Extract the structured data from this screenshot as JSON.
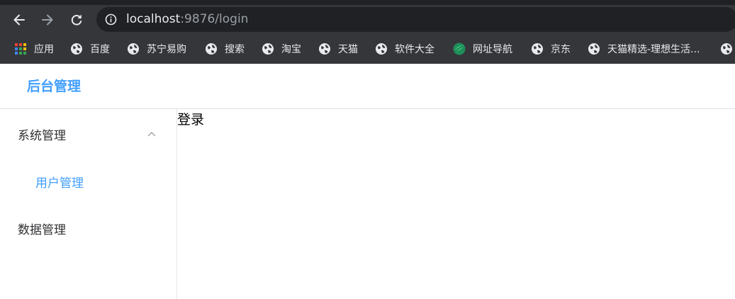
{
  "browser": {
    "url_host": "localhost",
    "url_rest": ":9876/login",
    "bookmarks": [
      {
        "label": "应用",
        "icon": "apps-grid-icon"
      },
      {
        "label": "百度",
        "icon": "globe-icon"
      },
      {
        "label": "苏宁易购",
        "icon": "globe-icon"
      },
      {
        "label": "搜索",
        "icon": "globe-icon"
      },
      {
        "label": "淘宝",
        "icon": "globe-icon"
      },
      {
        "label": "天猫",
        "icon": "globe-icon"
      },
      {
        "label": "软件大全",
        "icon": "globe-icon"
      },
      {
        "label": "网址导航",
        "icon": "green-leaf-icon"
      },
      {
        "label": "京东",
        "icon": "globe-icon"
      },
      {
        "label": "天猫精选-理想生活...",
        "icon": "globe-icon"
      }
    ]
  },
  "header": {
    "title": "后台管理"
  },
  "sidebar": {
    "menus": [
      {
        "label": "系统管理",
        "expanded": true,
        "items": [
          {
            "label": "用户管理",
            "active": true
          }
        ]
      },
      {
        "label": "数据管理",
        "expanded": false
      }
    ]
  },
  "main": {
    "title": "登录"
  },
  "colors": {
    "accent": "#409eff",
    "chrome_dark": "#35363a",
    "omnibox": "#202124",
    "text": "#303133",
    "divider": "#dcdfe6"
  }
}
